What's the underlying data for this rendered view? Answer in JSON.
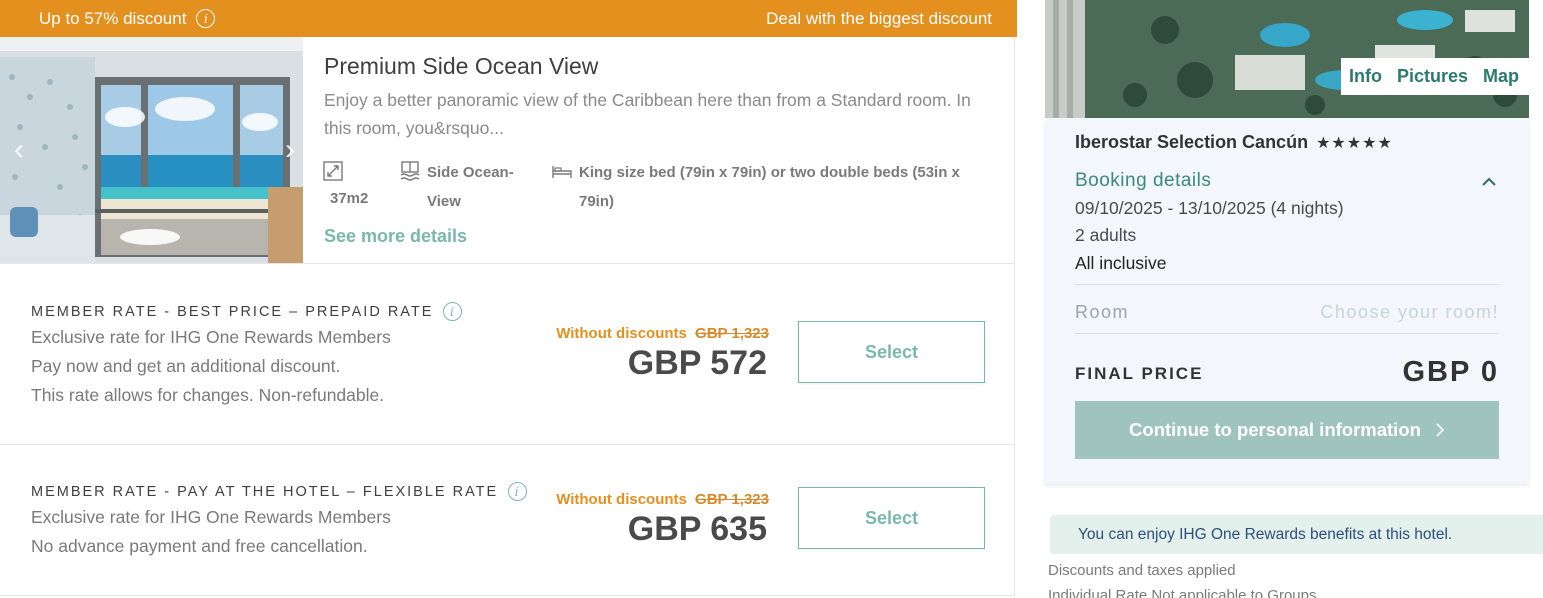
{
  "banner": {
    "discount": "Up to 57% discount",
    "deal": "Deal with the biggest discount"
  },
  "room": {
    "title": "Premium Side Ocean View",
    "description": "Enjoy a better panoramic view of the Caribbean here than from a Standard room. In this room, you&rsquo...",
    "features": {
      "size": "37m2",
      "view": "Side Ocean-View",
      "bed": "King size bed (79in x 79in) or two double beds (53in x 79in)"
    },
    "see_more": "See more details",
    "icons": {
      "prev": "chevron-left-icon",
      "next": "chevron-right-icon",
      "size": "area-icon",
      "view": "ocean-view-icon",
      "bed": "bed-icon"
    }
  },
  "rates": [
    {
      "title": "MEMBER RATE - BEST PRICE – PREPAID RATE",
      "lines": [
        "Exclusive rate for IHG One Rewards Members",
        "Pay now and get an additional discount.",
        "This rate allows for changes. Non-refundable."
      ],
      "without_label": "Without discounts",
      "old_price": "GBP 1,323",
      "price": "GBP 572",
      "select": "Select"
    },
    {
      "title": "MEMBER RATE - PAY AT THE HOTEL – FLEXIBLE RATE",
      "lines": [
        "Exclusive rate for IHG One Rewards Members",
        "No advance payment and free cancellation."
      ],
      "without_label": "Without discounts",
      "old_price": "GBP 1,323",
      "price": "GBP 635",
      "select": "Select"
    }
  ],
  "sidebar": {
    "tabs": [
      "Info",
      "Pictures",
      "Map"
    ],
    "hotel_name": "Iberostar Selection Cancún",
    "stars": "★★★★★",
    "booking_title": "Booking details",
    "dates": "09/10/2025 - 13/10/2025 (4 nights)",
    "adults": "2 adults",
    "board": "All inclusive",
    "room_label": "Room",
    "room_value": "Choose your room!",
    "final_label": "FINAL PRICE",
    "final_value": "GBP 0",
    "continue": "Continue to personal information",
    "rewards_note": "You can enjoy IHG One Rewards benefits at this hotel.",
    "footnote1": "Discounts and taxes applied",
    "footnote2": "Individual Rate Not applicable to Groups"
  },
  "colors": {
    "accent_orange": "#e3901f",
    "accent_teal": "#7ab8ac",
    "button_disabled": "#9fc4bd"
  }
}
